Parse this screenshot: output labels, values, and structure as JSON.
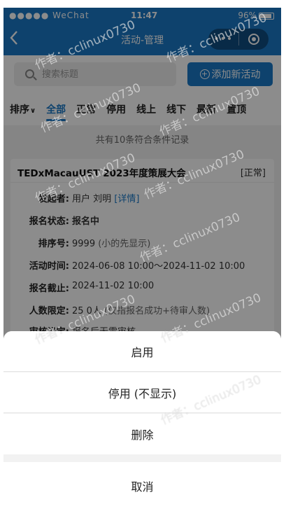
{
  "status_bar": {
    "signal": "●●●●● WeChat",
    "time": "11:47",
    "battery": "96%"
  },
  "nav": {
    "back_icon": "chevron-left-icon",
    "title": "活动-管理",
    "more": "•••"
  },
  "search": {
    "placeholder": "搜索标题",
    "add_button": "添加新活动"
  },
  "tabs": [
    "全部",
    "正常",
    "停用",
    "线上",
    "线下",
    "最新",
    "置顶"
  ],
  "sort_label": "排序",
  "active_tab_index": 0,
  "record_count": "共有10条符合条件记录",
  "card": {
    "title": "TEDxMacauUST 2023年度策展大会",
    "status": "[正常]",
    "rows": {
      "initiator": {
        "label": "发起者:",
        "prefix": "用户",
        "name": "刘明",
        "detail": "[详情]"
      },
      "reg_status": {
        "label": "报名状态:",
        "value": "报名中"
      },
      "sort_no": {
        "label": "排序号:",
        "value": "9999",
        "hint": "(小的先显示)"
      },
      "time": {
        "label": "活动时间:",
        "value": "2024-06-08 10:00～2024-11-02 10:00"
      },
      "deadline": {
        "label": "报名截止:",
        "value": "2024-11-02 10:00"
      },
      "limit": {
        "label": "人数限定:",
        "value": "25 0人",
        "hint": "(仅指报名成功+待审人数)"
      },
      "audit": {
        "label": "审核设定:",
        "value": "报名后无需审核"
      }
    }
  },
  "action_sheet": {
    "enable": "启用",
    "disable": "停用 (不显示)",
    "delete": "删除",
    "cancel": "取消"
  },
  "watermark": "作者：cclinux0730",
  "colors": {
    "primary": "#1b79c7",
    "danger": "#e53935",
    "warning": "#e67e22"
  }
}
